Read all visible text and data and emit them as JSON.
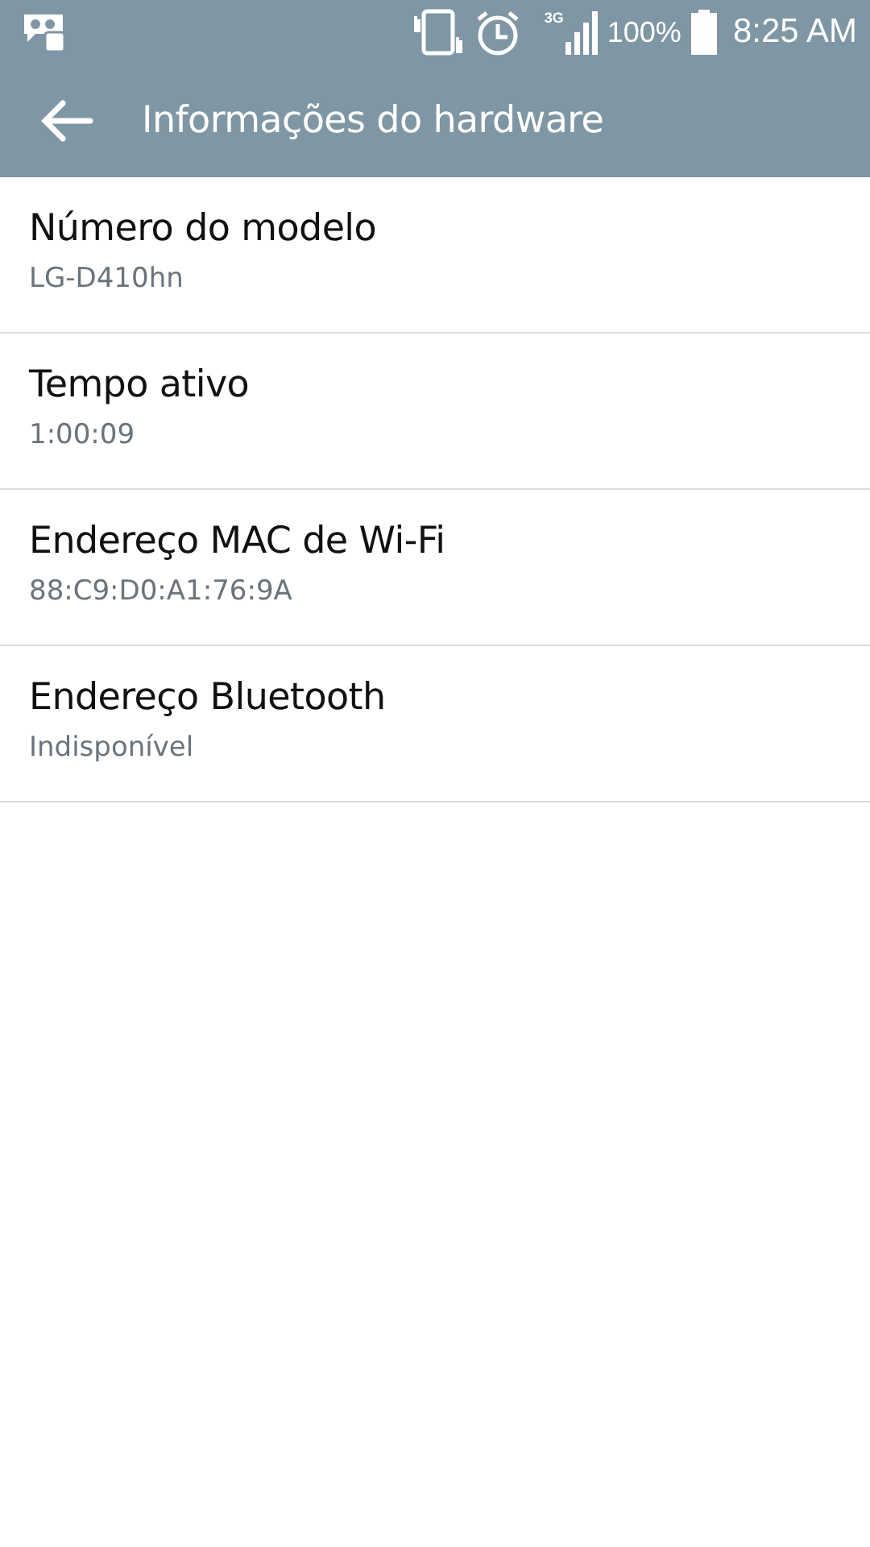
{
  "status_bar": {
    "network": "3G",
    "battery": "100%",
    "time": "8:25 AM"
  },
  "app_bar": {
    "title": "Informações do hardware"
  },
  "items": [
    {
      "title": "Número do modelo",
      "value": "LG-D410hn"
    },
    {
      "title": "Tempo ativo",
      "value": "1:00:09"
    },
    {
      "title": "Endereço MAC de Wi-Fi",
      "value": "88:C9:D0:A1:76:9A"
    },
    {
      "title": "Endereço Bluetooth",
      "value": "Indisponível"
    }
  ]
}
